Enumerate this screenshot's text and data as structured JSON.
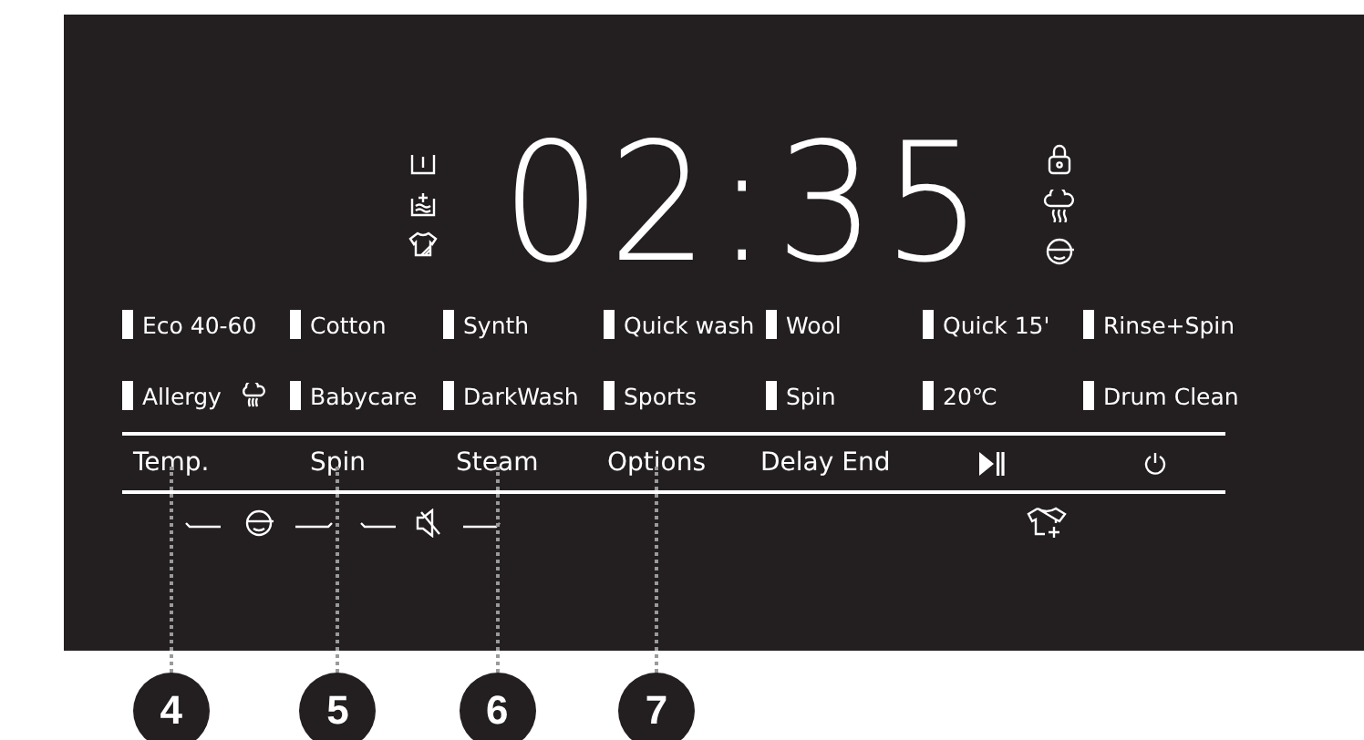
{
  "display": {
    "time": "02:35"
  },
  "programs": [
    {
      "label": "Eco 40-60",
      "kind": "plain"
    },
    {
      "label": "Cotton",
      "kind": "plain"
    },
    {
      "label": "Synth",
      "kind": "plain"
    },
    {
      "label": "Quick wash",
      "kind": "plain"
    },
    {
      "label": "Wool",
      "kind": "plain"
    },
    {
      "label": "Quick 15'",
      "kind": "plain"
    },
    {
      "label": "Rinse+Spin",
      "kind": "plain"
    },
    {
      "label": "Allergy",
      "kind": "steam"
    },
    {
      "label": "Babycare",
      "kind": "plain"
    },
    {
      "label": "DarkWash",
      "kind": "plain"
    },
    {
      "label": "Sports",
      "kind": "plain"
    },
    {
      "label": "Spin",
      "kind": "plain"
    },
    {
      "label": "20℃",
      "kind": "plain"
    },
    {
      "label": "Drum Clean",
      "kind": "plain"
    }
  ],
  "buttons": [
    {
      "kind": "text",
      "label": "Temp."
    },
    {
      "kind": "text",
      "label": "Spin"
    },
    {
      "kind": "text",
      "label": "Steam"
    },
    {
      "kind": "text",
      "label": "Options"
    },
    {
      "kind": "text",
      "label": "Delay End"
    },
    {
      "kind": "play-pause"
    },
    {
      "kind": "power"
    }
  ],
  "callouts": [
    {
      "number": "4"
    },
    {
      "number": "5"
    },
    {
      "number": "6"
    },
    {
      "number": "7"
    }
  ]
}
